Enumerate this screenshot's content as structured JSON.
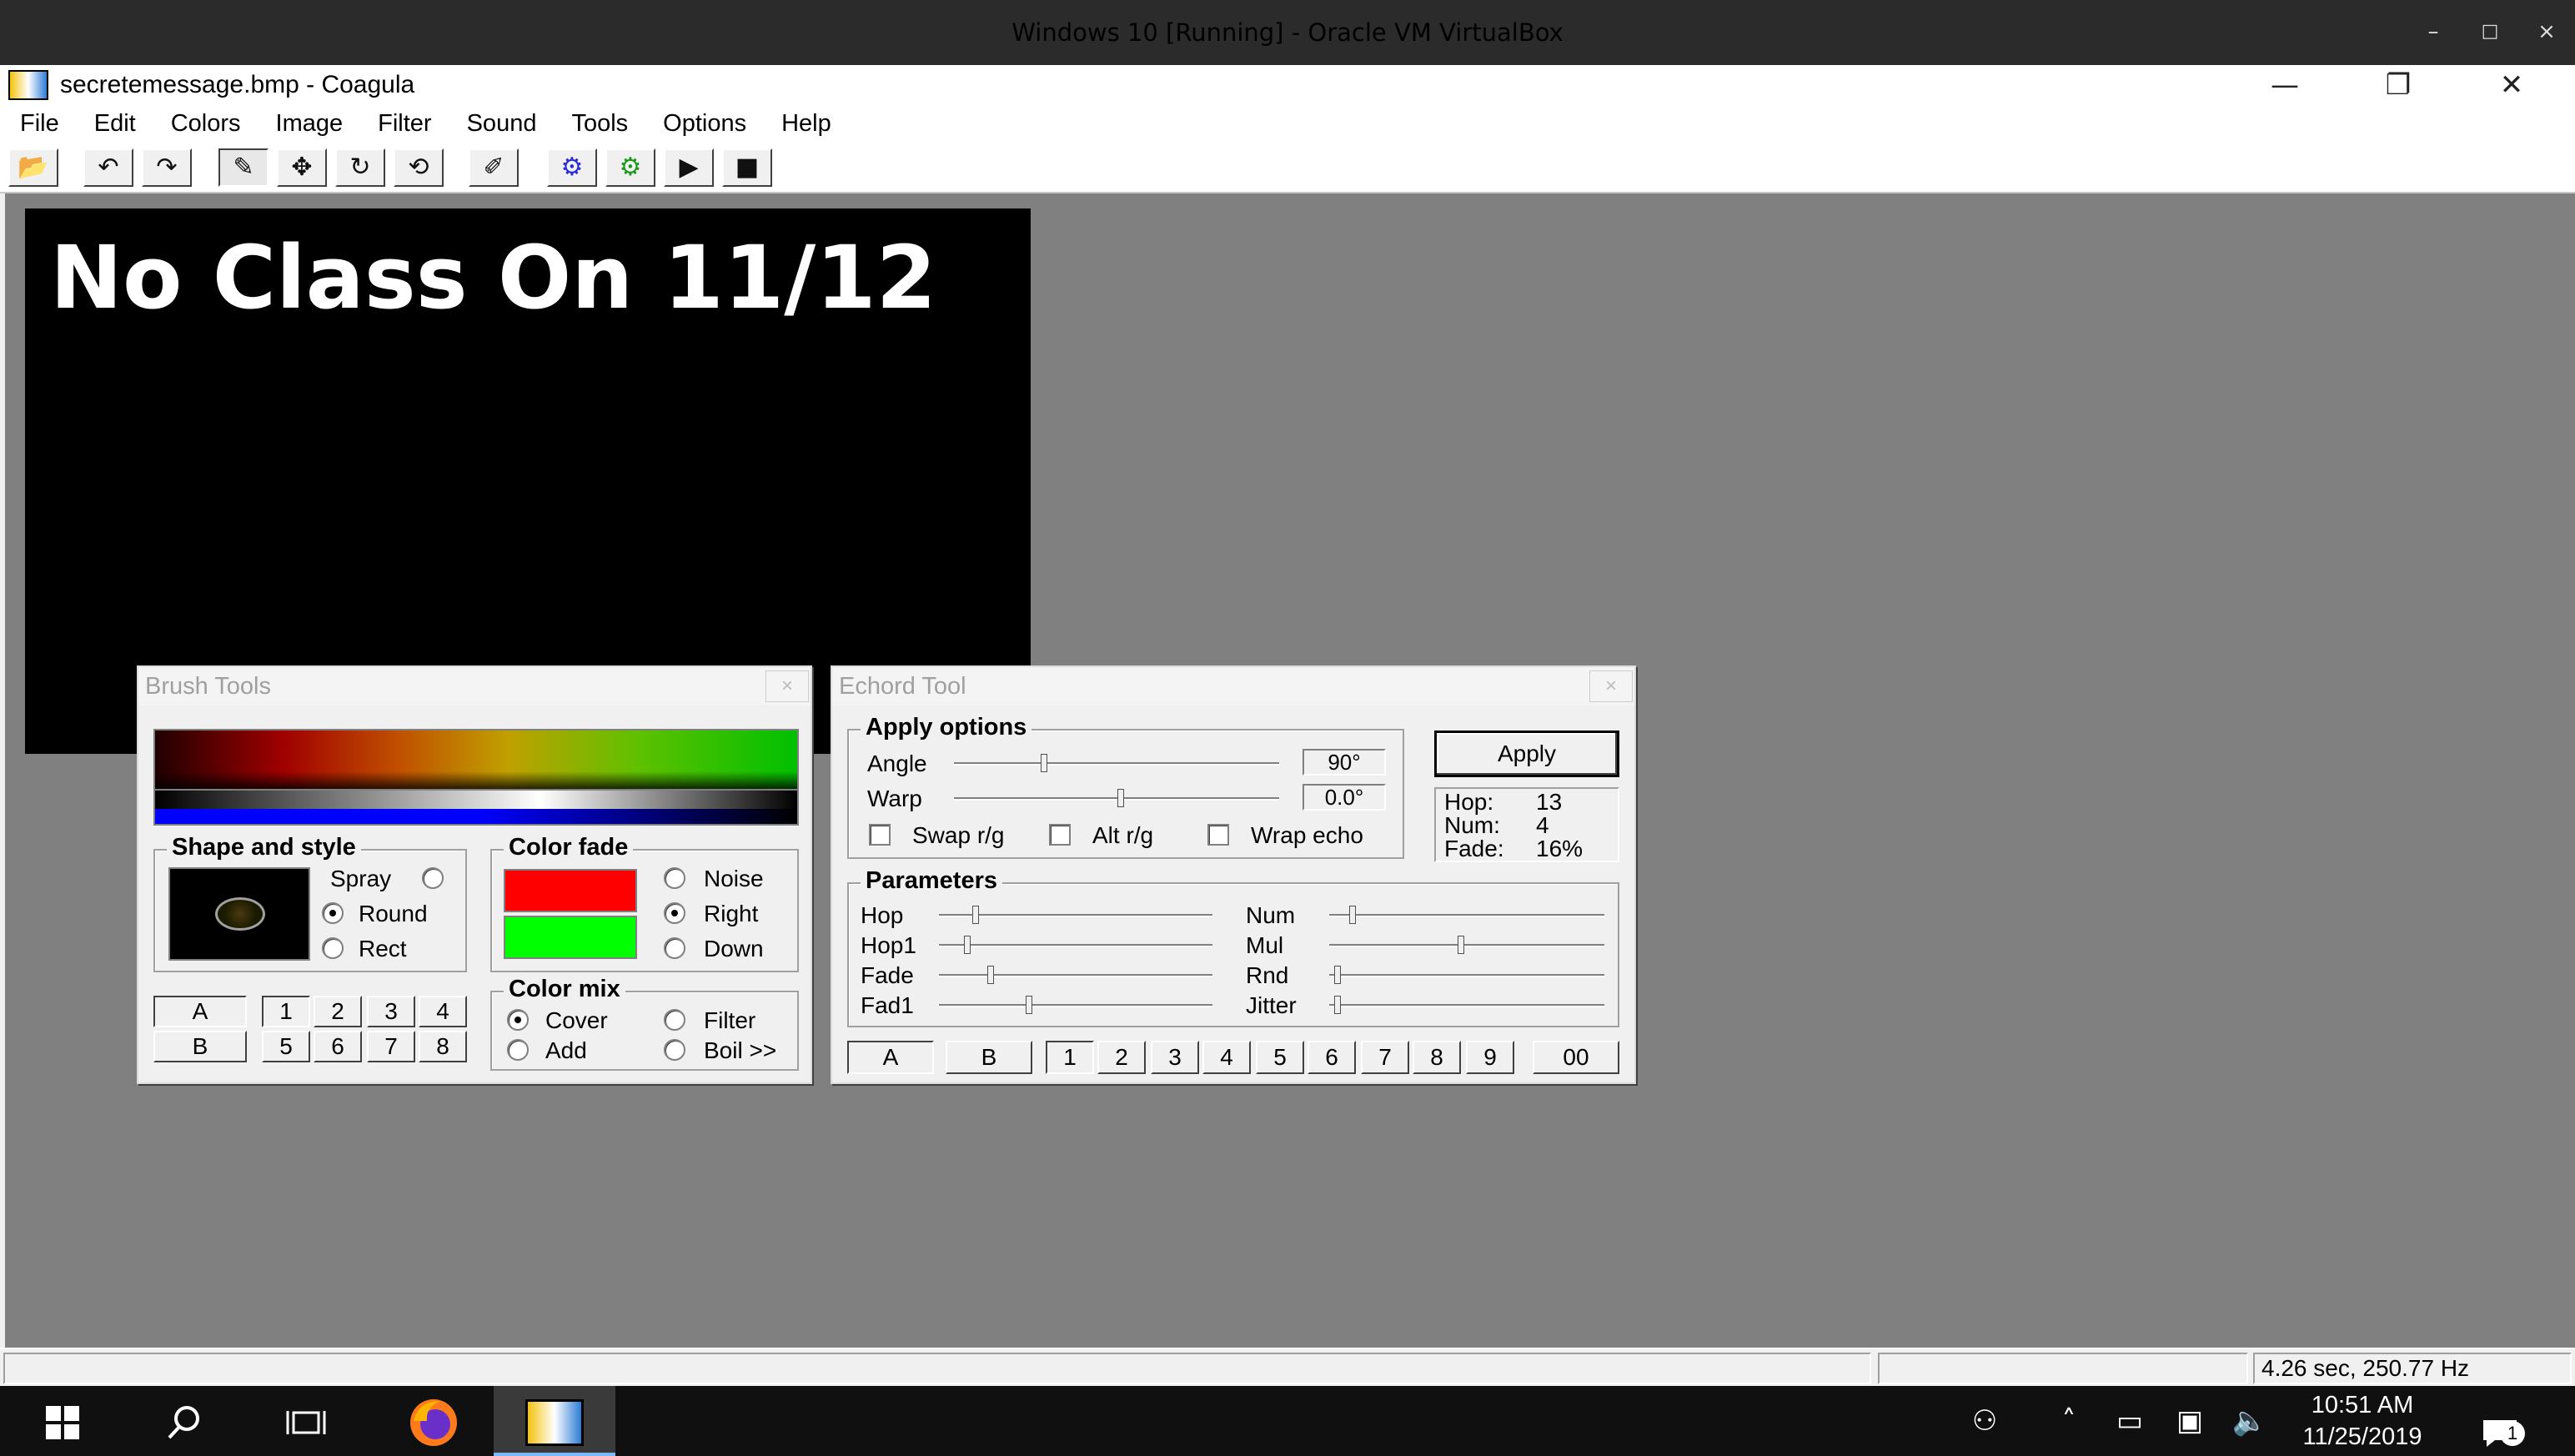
{
  "host": {
    "title": "Windows 10 [Running] - Oracle VM VirtualBox",
    "controls": {
      "minimize": "–",
      "maximize": "□",
      "close": "×"
    }
  },
  "app": {
    "title": "secretemessage.bmp - Coagula",
    "icon": "coagula-app-icon",
    "controls": {
      "minimize": "—",
      "restore": "❐",
      "close": "✕"
    }
  },
  "menu": [
    "File",
    "Edit",
    "Colors",
    "Image",
    "Filter",
    "Sound",
    "Tools",
    "Options",
    "Help"
  ],
  "toolbar": {
    "buttons": [
      {
        "name": "open-image-icon",
        "glyph": "📂"
      },
      {
        "name": "undo-icon",
        "glyph": "↶"
      },
      {
        "name": "redo-icon",
        "glyph": "↷"
      },
      {
        "name": "brush-icon",
        "glyph": "✎"
      },
      {
        "name": "move-icon",
        "glyph": "✥"
      },
      {
        "name": "rotate-icon",
        "glyph": "↻"
      },
      {
        "name": "transform-icon",
        "glyph": "⟲"
      },
      {
        "name": "eraser-icon",
        "glyph": "✐"
      },
      {
        "name": "render-image-icon",
        "glyph": "⚙"
      },
      {
        "name": "render-no-blur-icon",
        "glyph": "⚙"
      },
      {
        "name": "play-icon",
        "glyph": "▶"
      },
      {
        "name": "stop-icon",
        "glyph": "■"
      }
    ]
  },
  "canvas": {
    "text": "No Class On 11/12"
  },
  "brush_tools": {
    "title": "Brush Tools",
    "close": "×",
    "shape_group": "Shape and style",
    "shape_options": [
      "Spray",
      "Round",
      "Rect"
    ],
    "shape_selected": "Round",
    "color_fade_group": "Color fade",
    "fade_options": [
      "Noise",
      "Right",
      "Down"
    ],
    "fade_selected": "Right",
    "fade_colors": {
      "top": "#ff0000",
      "bottom": "#00ff00"
    },
    "color_mix_group": "Color mix",
    "mix_options": [
      "Cover",
      "Filter",
      "Add",
      "Boil >>"
    ],
    "mix_selected": "Cover",
    "bank_a": "A",
    "bank_b": "B",
    "presets_top": [
      "1",
      "2",
      "3",
      "4"
    ],
    "presets_bottom": [
      "5",
      "6",
      "7",
      "8"
    ]
  },
  "echord": {
    "title": "Echord Tool",
    "close": "×",
    "apply_group": "Apply options",
    "angle_label": "Angle",
    "angle_value": "90°",
    "warp_label": "Warp",
    "warp_value": "0.0°",
    "apply_button": "Apply",
    "info": {
      "hop_label": "Hop:",
      "hop": "13",
      "num_label": "Num:",
      "num": "4",
      "fade_label": "Fade:",
      "fade": "16%"
    },
    "checkboxes": [
      "Swap r/g",
      "Alt r/g",
      "Wrap echo"
    ],
    "params_group": "Parameters",
    "params_left": [
      "Hop",
      "Hop1",
      "Fade",
      "Fad1"
    ],
    "params_right": [
      "Num",
      "Mul",
      "Rnd",
      "Jitter"
    ],
    "bank_a": "A",
    "bank_b": "B",
    "presets": [
      "1",
      "2",
      "3",
      "4",
      "5",
      "6",
      "7",
      "8",
      "9"
    ],
    "extra_preset": "00"
  },
  "status": {
    "info": "4.26 sec, 250.77 Hz"
  },
  "taskbar": {
    "clock_time": "10:51 AM",
    "clock_date": "11/25/2019",
    "notification_count": "1"
  }
}
